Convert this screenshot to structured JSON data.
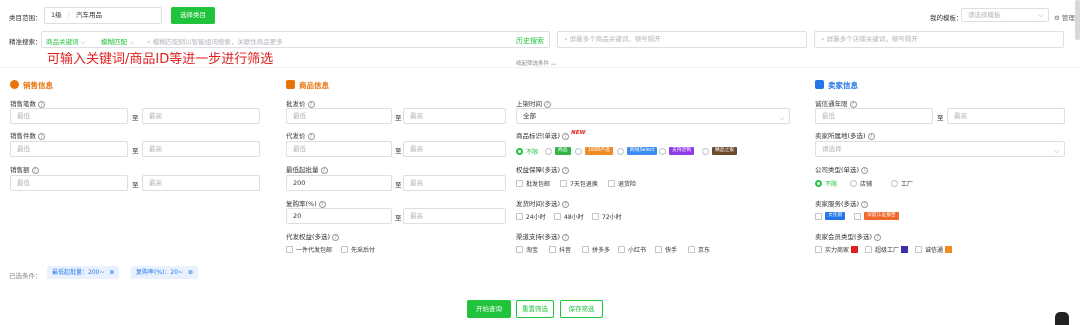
{
  "colors": {
    "accent": "#20c33c",
    "sales": "#e8740c",
    "seller": "#2476e8",
    "annotation": "#e02020"
  },
  "category": {
    "label": "类目范围：",
    "level": "1级",
    "value": "汽车用品",
    "button": "选择类目"
  },
  "template": {
    "label": "我的模板：",
    "placeholder": "请选择模板",
    "manage": "管理"
  },
  "search": {
    "label": "精准搜索：",
    "mode1": "商品关键词",
    "mode2": "模糊匹配",
    "placeholder": "模糊匹配则以智能组词搜索，关联性商品更多",
    "history": "历史搜索",
    "exclude_goods": "屏蔽多个商品关键词，顿号隔开",
    "exclude_shop": "屏蔽多个店铺关键词，顿号隔开"
  },
  "annotation": "可输入关键词/商品ID等进一步进行筛选",
  "collapse": "收起筛选条件",
  "common": {
    "min": "最低",
    "max": "最高",
    "to": "至"
  },
  "sales": {
    "title": "销售信息",
    "f1": "销售笔数",
    "f2": "销售件数",
    "f3": "销售额"
  },
  "goods": {
    "title": "商品信息",
    "f1": "批发价",
    "f2": "代发价",
    "f3": "最低起批量",
    "f3_min": "200",
    "f4": "复购率(%)",
    "f4_min": "20",
    "f5": "代发权益(多选)",
    "opt1": "一件代发包邮",
    "opt2": "先采后付"
  },
  "mid": {
    "f1": "上架时间",
    "select": "全部",
    "f2": "商品标识(单选)",
    "new": "NEW",
    "none": "不限",
    "badges": [
      "商品",
      "1688严选",
      "跨境Select",
      "支持定制",
      "精品之家"
    ],
    "f3": "权益保障(多选)",
    "g": [
      "批发包邮",
      "7天包退换",
      "退货险"
    ],
    "f4": "发货时间(多选)",
    "t": [
      "24小时",
      "48小时",
      "72小时"
    ],
    "f5": "渠道支持(多选)",
    "c": [
      "淘宝",
      "抖音",
      "拼多多",
      "小红书",
      "快手",
      "京东"
    ]
  },
  "seller": {
    "title": "卖家信息",
    "f1": "诚信通年限",
    "f2": "卖家所属地(多选)",
    "region_ph": "请选择",
    "f3": "公司类型(单选)",
    "r": [
      "不限",
      "店铺",
      "工厂"
    ],
    "f4": "卖家服务(多选)",
    "s1": "文化街",
    "s2": "深度认证报告",
    "f5": "卖家会员类型(多选)",
    "m": [
      "实力商家",
      "超级工厂",
      "诚信通"
    ]
  },
  "selected": {
    "label": "已选条件：",
    "t1": "最低起批量：200~",
    "t2": "复购率(%)：20~"
  },
  "actions": {
    "search": "开始查询",
    "reset": "重置筛选",
    "save": "保存筛选"
  }
}
